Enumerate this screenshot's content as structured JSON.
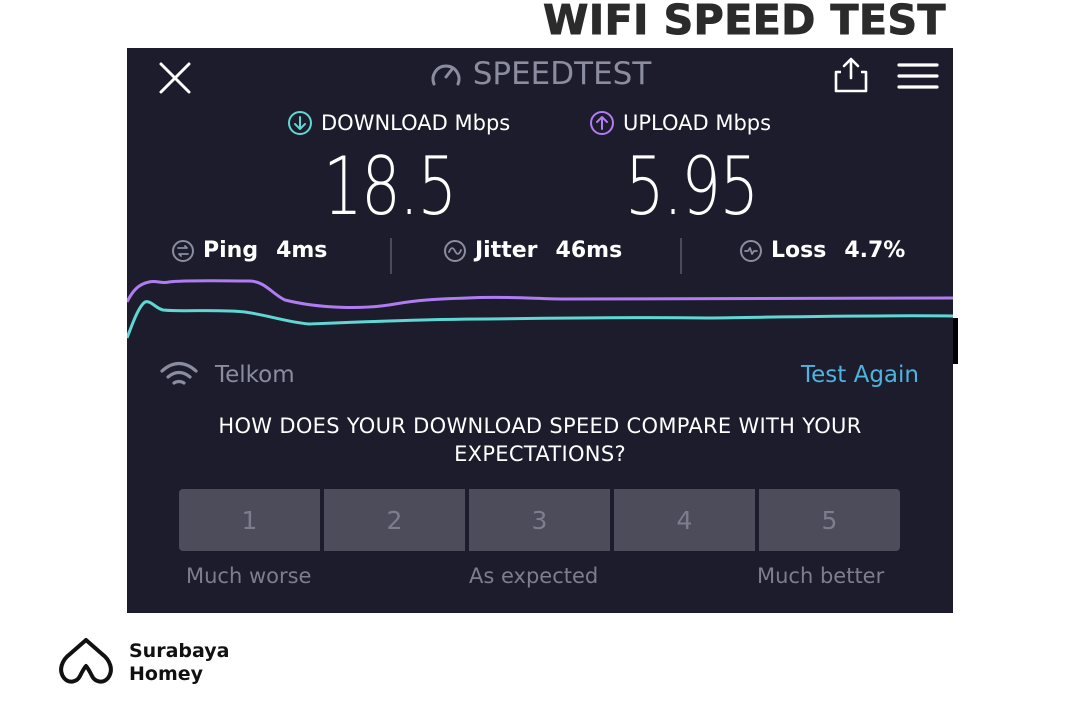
{
  "banner": {
    "title": "WIFI SPEED TEST"
  },
  "app": {
    "title": "SPEEDTEST"
  },
  "icons": {
    "close": "close-icon",
    "gauge": "gauge-icon",
    "share": "share-icon",
    "menu": "hamburger-menu-icon",
    "download": "download-arrow-icon",
    "upload": "upload-arrow-icon",
    "ping": "ping-icon",
    "jitter": "jitter-icon",
    "loss": "packet-loss-icon",
    "wifi": "wifi-icon"
  },
  "download": {
    "label": "DOWNLOAD Mbps",
    "value": "18.5",
    "color": "#5fd7d4"
  },
  "upload": {
    "label": "UPLOAD Mbps",
    "value": "5.95",
    "color": "#b07cf2"
  },
  "stats": {
    "ping": {
      "label": "Ping",
      "value": "4ms"
    },
    "jitter": {
      "label": "Jitter",
      "value": "46ms"
    },
    "loss": {
      "label": "Loss",
      "value": "4.7%"
    }
  },
  "network": {
    "name": "Telkom"
  },
  "actions": {
    "test_again": "Test Again"
  },
  "survey": {
    "question": "HOW DOES YOUR DOWNLOAD SPEED COMPARE WITH YOUR EXPECTATIONS?",
    "options": [
      "1",
      "2",
      "3",
      "4",
      "5"
    ],
    "scale": {
      "low": "Much worse",
      "mid": "As expected",
      "high": "Much better"
    }
  },
  "brand": {
    "line1": "Surabaya",
    "line2": "Homey"
  },
  "colors": {
    "background": "#1d1c2c",
    "accent": "#4fb3e0",
    "button": "#4d4c5a"
  }
}
